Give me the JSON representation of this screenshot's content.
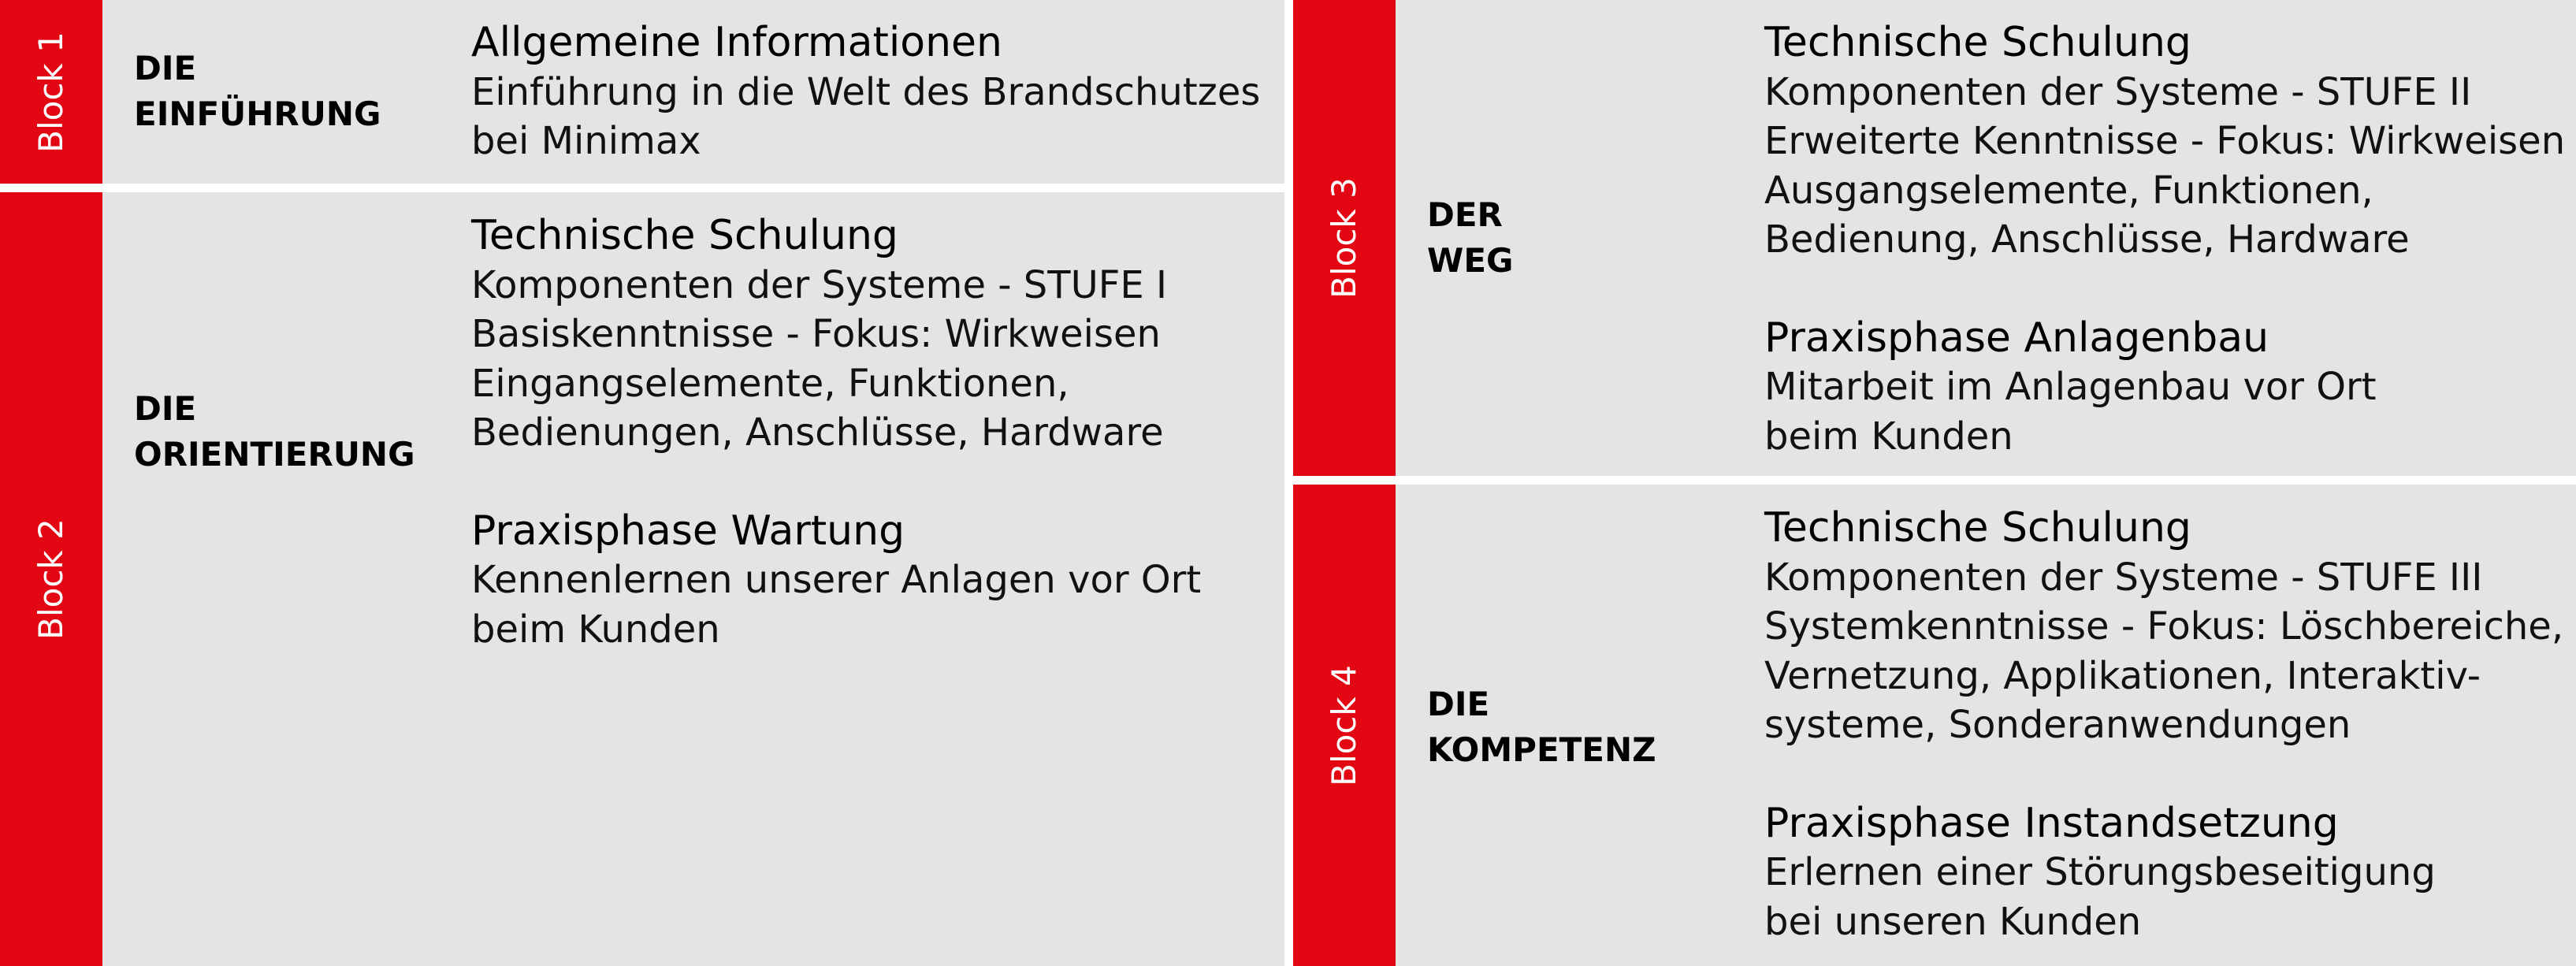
{
  "brand_color": "#e30613",
  "panel_color": "#e4e4e4",
  "blocks": [
    {
      "label": "Block 1",
      "title": [
        "DIE",
        "EINFÜHRUNG"
      ],
      "sections": [
        {
          "heading": "Allgemeine Informationen",
          "lines": [
            "Einführung in die Welt des Brandschutzes",
            "bei Minimax"
          ]
        }
      ]
    },
    {
      "label": "Block 2",
      "title": [
        "DIE",
        "ORIENTIERUNG"
      ],
      "sections": [
        {
          "heading": "Technische Schulung",
          "lines": [
            "Komponenten der Systeme - STUFE I",
            "Basiskenntnisse - Fokus: Wirkweisen",
            "Eingangselemente, Funktionen,",
            "Bedienungen, Anschlüsse, Hardware"
          ]
        },
        {
          "heading": "Praxisphase Wartung",
          "lines": [
            "Kennenlernen unserer Anlagen vor Ort",
            "beim Kunden"
          ]
        }
      ]
    },
    {
      "label": "Block 3",
      "title": [
        "DER",
        "WEG"
      ],
      "sections": [
        {
          "heading": "Technische Schulung",
          "lines": [
            "Komponenten der Systeme - STUFE II",
            "Erweiterte Kenntnisse - Fokus: Wirkweisen",
            "Ausgangselemente, Funktionen,",
            "Bedienung, Anschlüsse, Hardware"
          ]
        },
        {
          "heading": "Praxisphase Anlagenbau",
          "lines": [
            "Mitarbeit im Anlagenbau vor Ort",
            "beim Kunden"
          ]
        }
      ]
    },
    {
      "label": "Block 4",
      "title": [
        "DIE",
        "KOMPETENZ"
      ],
      "sections": [
        {
          "heading": "Technische Schulung",
          "lines": [
            "Komponenten der Systeme - STUFE III",
            "Systemkenntnisse - Fokus:  Löschbereiche,",
            "Vernetzung, Applikationen,  Interaktiv-",
            "systeme, Sonderanwendungen"
          ]
        },
        {
          "heading": "Praxisphase Instandsetzung",
          "lines": [
            "Erlernen einer Störungsbeseitigung",
            "bei unseren Kunden"
          ]
        }
      ]
    }
  ]
}
